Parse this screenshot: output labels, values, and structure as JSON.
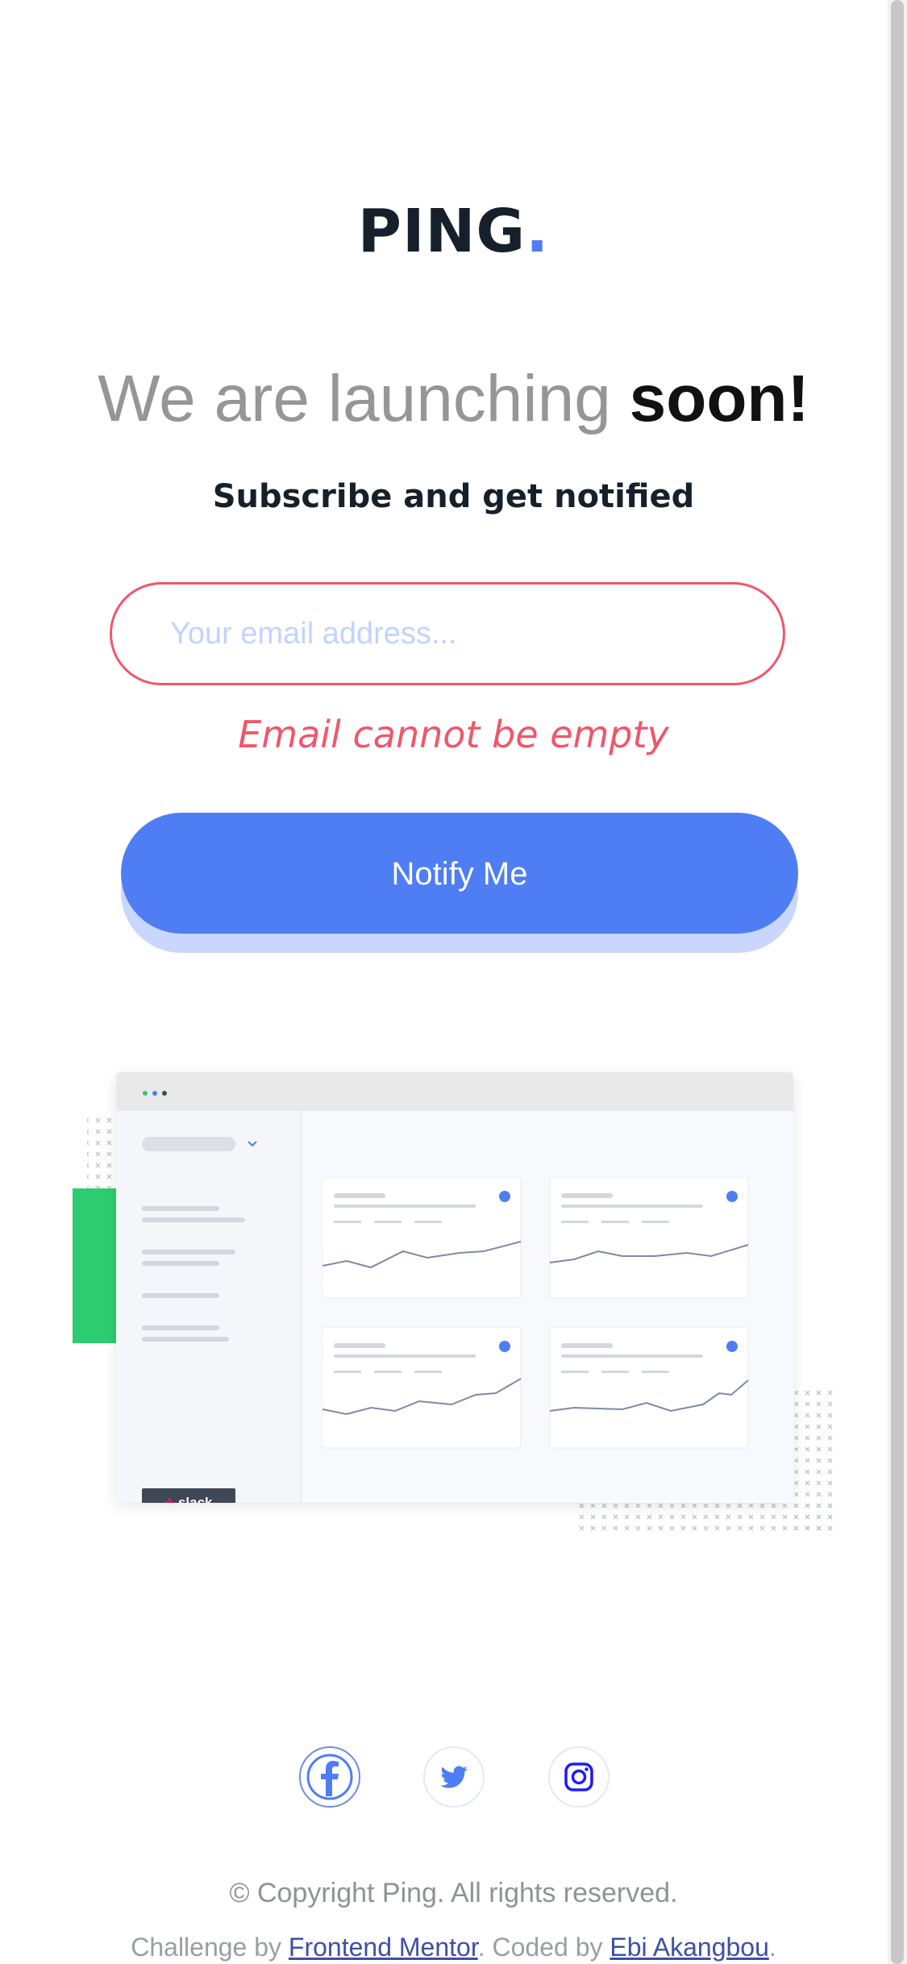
{
  "logo": {
    "text": "PING",
    "dot": "."
  },
  "headline": {
    "light": "We are launching",
    "strong": "soon!"
  },
  "subheading": "Subscribe and get notified",
  "form": {
    "email_placeholder": "Your email address...",
    "email_value": "",
    "error_message": "Email cannot be empty",
    "submit_label": "Notify Me"
  },
  "illustration": {
    "sidebar_badge": "slack"
  },
  "social": [
    {
      "icon": "facebook-icon"
    },
    {
      "icon": "twitter-icon"
    },
    {
      "icon": "instagram-icon"
    }
  ],
  "footer": {
    "copyright": "© Copyright Ping. All rights reserved.",
    "challenge_prefix": "Challenge by ",
    "challenge_link": "Frontend Mentor",
    "coded_prefix": ". Coded by ",
    "author_link": "Ebi Akangbou",
    "suffix": "."
  },
  "colors": {
    "brand_blue": "#4f7df3",
    "error_red": "#f0566a",
    "text_dark": "#15202a",
    "accent_green": "#2ecc71"
  }
}
